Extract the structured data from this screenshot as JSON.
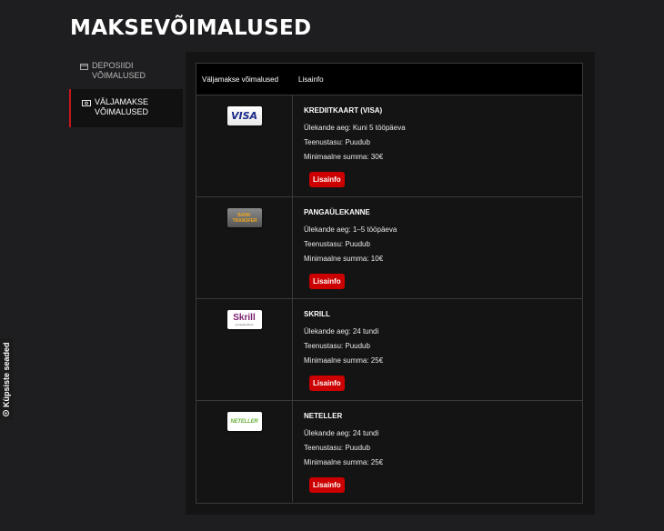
{
  "page": {
    "title": "MAKSEVÕIMALUSED"
  },
  "sidebar": {
    "items": [
      {
        "label": "DEPOSIIDI VÕIMALUSED",
        "icon": "card-icon",
        "active": false
      },
      {
        "label": "VÄLJAMAKSE VÕIMALUSED",
        "icon": "cash-icon",
        "active": true
      }
    ]
  },
  "table": {
    "headers": {
      "method": "Väljamakse võimalused",
      "info": "Lisainfo"
    },
    "rows": [
      {
        "name": "KREDIITKAART (VISA)",
        "logo_text": "VISA",
        "logo": "visa-logo",
        "transfer": "Ülekande aeg: Kuni 5 tööpäeva",
        "fee": "Teenustasu: Puudub",
        "min": "Minimaalne summa: 30€",
        "button": "Lisainfo"
      },
      {
        "name": "PANGAÜLEKANNE",
        "logo_text": "BANK TRANSFER",
        "logo": "bank-transfer-logo",
        "transfer": "Ülekande aeg: 1–5 tööpäeva",
        "fee": "Teenustasu: Puudub",
        "min": "Minimaalne summa: 10€",
        "button": "Lisainfo"
      },
      {
        "name": "SKRILL",
        "logo_text": "Skrill",
        "logo_sub": "moneybookers",
        "logo": "skrill-logo",
        "transfer": "Ülekande aeg: 24 tundi",
        "fee": "Teenustasu: Puudub",
        "min": "Minimaalne summa: 25€",
        "button": "Lisainfo"
      },
      {
        "name": "NETELLER",
        "logo_text": "NETELLER",
        "logo": "neteller-logo",
        "transfer": "Ülekande aeg: 24 tundi",
        "fee": "Teenustasu: Puudub",
        "min": "Minimaalne summa: 25€",
        "button": "Lisainfo"
      }
    ]
  },
  "cookie_tab": {
    "label": "Küpsiste seaded",
    "icon": "gear-icon"
  },
  "colors": {
    "accent": "#cc0000",
    "background": "#1e1e20",
    "panel": "#141414"
  }
}
